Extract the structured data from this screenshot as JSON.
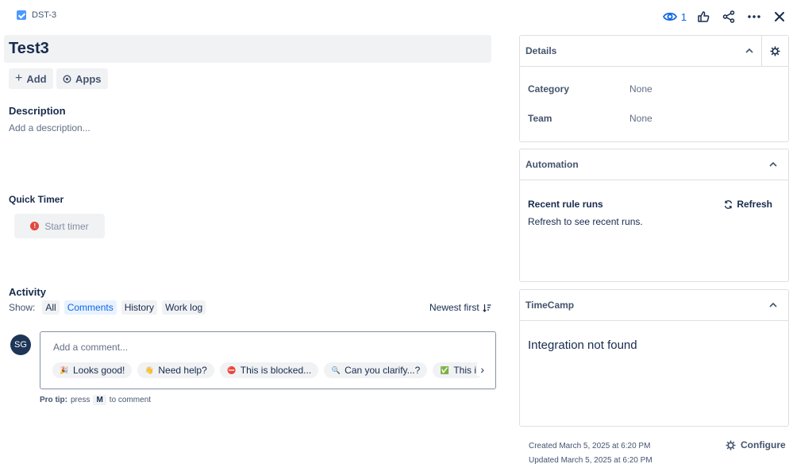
{
  "header": {
    "issue_key": "DST-3",
    "watch_count": "1"
  },
  "issue": {
    "title": "Test3",
    "add_label": "Add",
    "apps_label": "Apps"
  },
  "description": {
    "heading": "Description",
    "placeholder": "Add a description..."
  },
  "quick_timer": {
    "heading": "Quick Timer",
    "start_label": "Start timer"
  },
  "activity": {
    "heading": "Activity",
    "show_label": "Show:",
    "filters": [
      "All",
      "Comments",
      "History",
      "Work log"
    ],
    "active_filter": "Comments",
    "sort_label": "Newest first"
  },
  "comment": {
    "avatar_initials": "SG",
    "placeholder": "Add a comment...",
    "chips": [
      {
        "emoji": "🎉",
        "label": "Looks good!"
      },
      {
        "emoji": "👋",
        "label": "Need help?"
      },
      {
        "emoji": "⛔",
        "label": "This is blocked..."
      },
      {
        "emoji": "🔍",
        "label": "Can you clarify...?"
      },
      {
        "emoji": "✅",
        "label": "This i"
      }
    ],
    "pro_tip_label": "Pro tip:",
    "pro_tip_press": "press",
    "pro_tip_key": "M",
    "pro_tip_suffix": "to comment"
  },
  "details": {
    "heading": "Details",
    "fields": [
      {
        "label": "Category",
        "value": "None"
      },
      {
        "label": "Team",
        "value": "None"
      }
    ]
  },
  "automation": {
    "heading": "Automation",
    "recent_label": "Recent rule runs",
    "refresh_label": "Refresh",
    "hint": "Refresh to see recent runs."
  },
  "timecamp": {
    "heading": "TimeCamp",
    "message": "Integration not found"
  },
  "footer": {
    "created": "Created March 5, 2025 at 6:20 PM",
    "updated": "Updated March 5, 2025 at 6:20 PM",
    "configure_label": "Configure"
  },
  "colors": {
    "accent": "#0c66e4",
    "warning": "#e2483d",
    "checkbox": "#4c9aff"
  }
}
